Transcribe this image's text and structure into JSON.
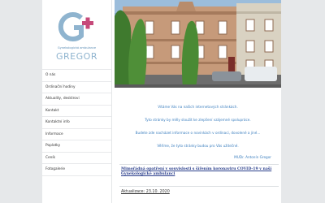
{
  "logo": {
    "subtitle": "Gynekologická ambulance",
    "name": "GREGOR"
  },
  "nav": [
    {
      "label": "O nás"
    },
    {
      "label": "Ordinační hodiny"
    },
    {
      "label": "Aktuality, desktrovi"
    },
    {
      "label": "Kontakt"
    },
    {
      "label": "Kontaktní info"
    },
    {
      "label": "Informace"
    },
    {
      "label": "Poplatky"
    },
    {
      "label": "Ceník"
    },
    {
      "label": "Fotogalerie"
    }
  ],
  "welcome": {
    "lines": [
      "Vítáme Vás na našich internetových stránkách.",
      "Tyto stránky by měly sloužit ke zlepšení vzájemné spolupráce.",
      "Budete zde nacházet informace o novinkách v ordinaci, dovolené a jiné...",
      "Věříme, že tyto stránky budou pro Vás užitečné."
    ],
    "signature": "MUDr. Antonín Gregor"
  },
  "notice": "Mimořádná opatření v souvislosti s šířením koronaviru COVID-19 v naší Gynekologické ambulanci",
  "updated": "Aktualizace: 23.10. 2020",
  "colors": {
    "accent_blue": "#3c7fbf",
    "logo_teal": "#8fb4cf",
    "logo_cross": "#c64a7a",
    "link_navy": "#2b3f8c"
  }
}
